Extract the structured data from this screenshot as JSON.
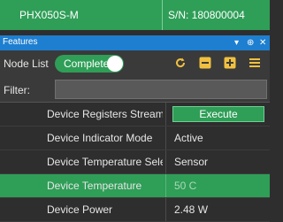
{
  "topbar": {
    "device": "PHX050S-M",
    "serial": "S/N: 180800004"
  },
  "panel": {
    "title": "Features",
    "controls": {
      "pin": "▾",
      "pin2": "⊕",
      "close": "✕"
    }
  },
  "toolbar": {
    "node_list_label": "Node List",
    "toggle_label": "Complete",
    "icons": [
      "refresh-icon",
      "collapse-icon",
      "expand-icon",
      "menu-icon"
    ]
  },
  "filter": {
    "label": "Filter:",
    "value": ""
  },
  "rows": [
    {
      "name": "Device Registers Streaming",
      "value": "Execute",
      "is_button": true
    },
    {
      "name": "Device Indicator Mode",
      "value": "Active"
    },
    {
      "name": "Device Temperature Selector",
      "value": "Sensor"
    },
    {
      "name": "Device Temperature",
      "value": "50 C",
      "selected": true
    },
    {
      "name": "Device Power",
      "value": "2.48 W"
    }
  ],
  "colors": {
    "accent": "#2f9e57",
    "titlebar": "#1e7fd0",
    "background": "#2e2e2e"
  }
}
